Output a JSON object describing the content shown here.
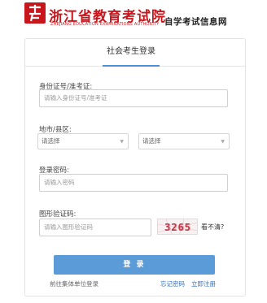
{
  "header": {
    "title": "浙江省教育考试院",
    "subtitle": "ZHEJIANG EDUCATION EXAMINATIONS AUTHORITY",
    "site_tag": "自学考试信息网",
    "logo_icon": "zjzk-logo-icon",
    "brand_color": "#c8161d"
  },
  "tab": {
    "label": "社会考生登录",
    "accent": "#4a8fd8"
  },
  "form": {
    "id_label": "身份证号/准考证:",
    "id_placeholder": "请输入身份证号/准考证",
    "region_label": "地市/县区:",
    "city_select": "请选择",
    "district_select": "请选择",
    "password_label": "登录密码:",
    "password_placeholder": "请输入密码",
    "captcha_label": "图形验证码:",
    "captcha_placeholder": "请输入图形验证码",
    "captcha_value": "3265",
    "refresh_label": "看不清?"
  },
  "actions": {
    "login_label": "登 录",
    "group_link": "前往集体单位登录",
    "forgot_link": "忘记密码",
    "register_link": "立即注册",
    "button_color": "#5b9bd8",
    "link_color": "#2f6fbf"
  }
}
